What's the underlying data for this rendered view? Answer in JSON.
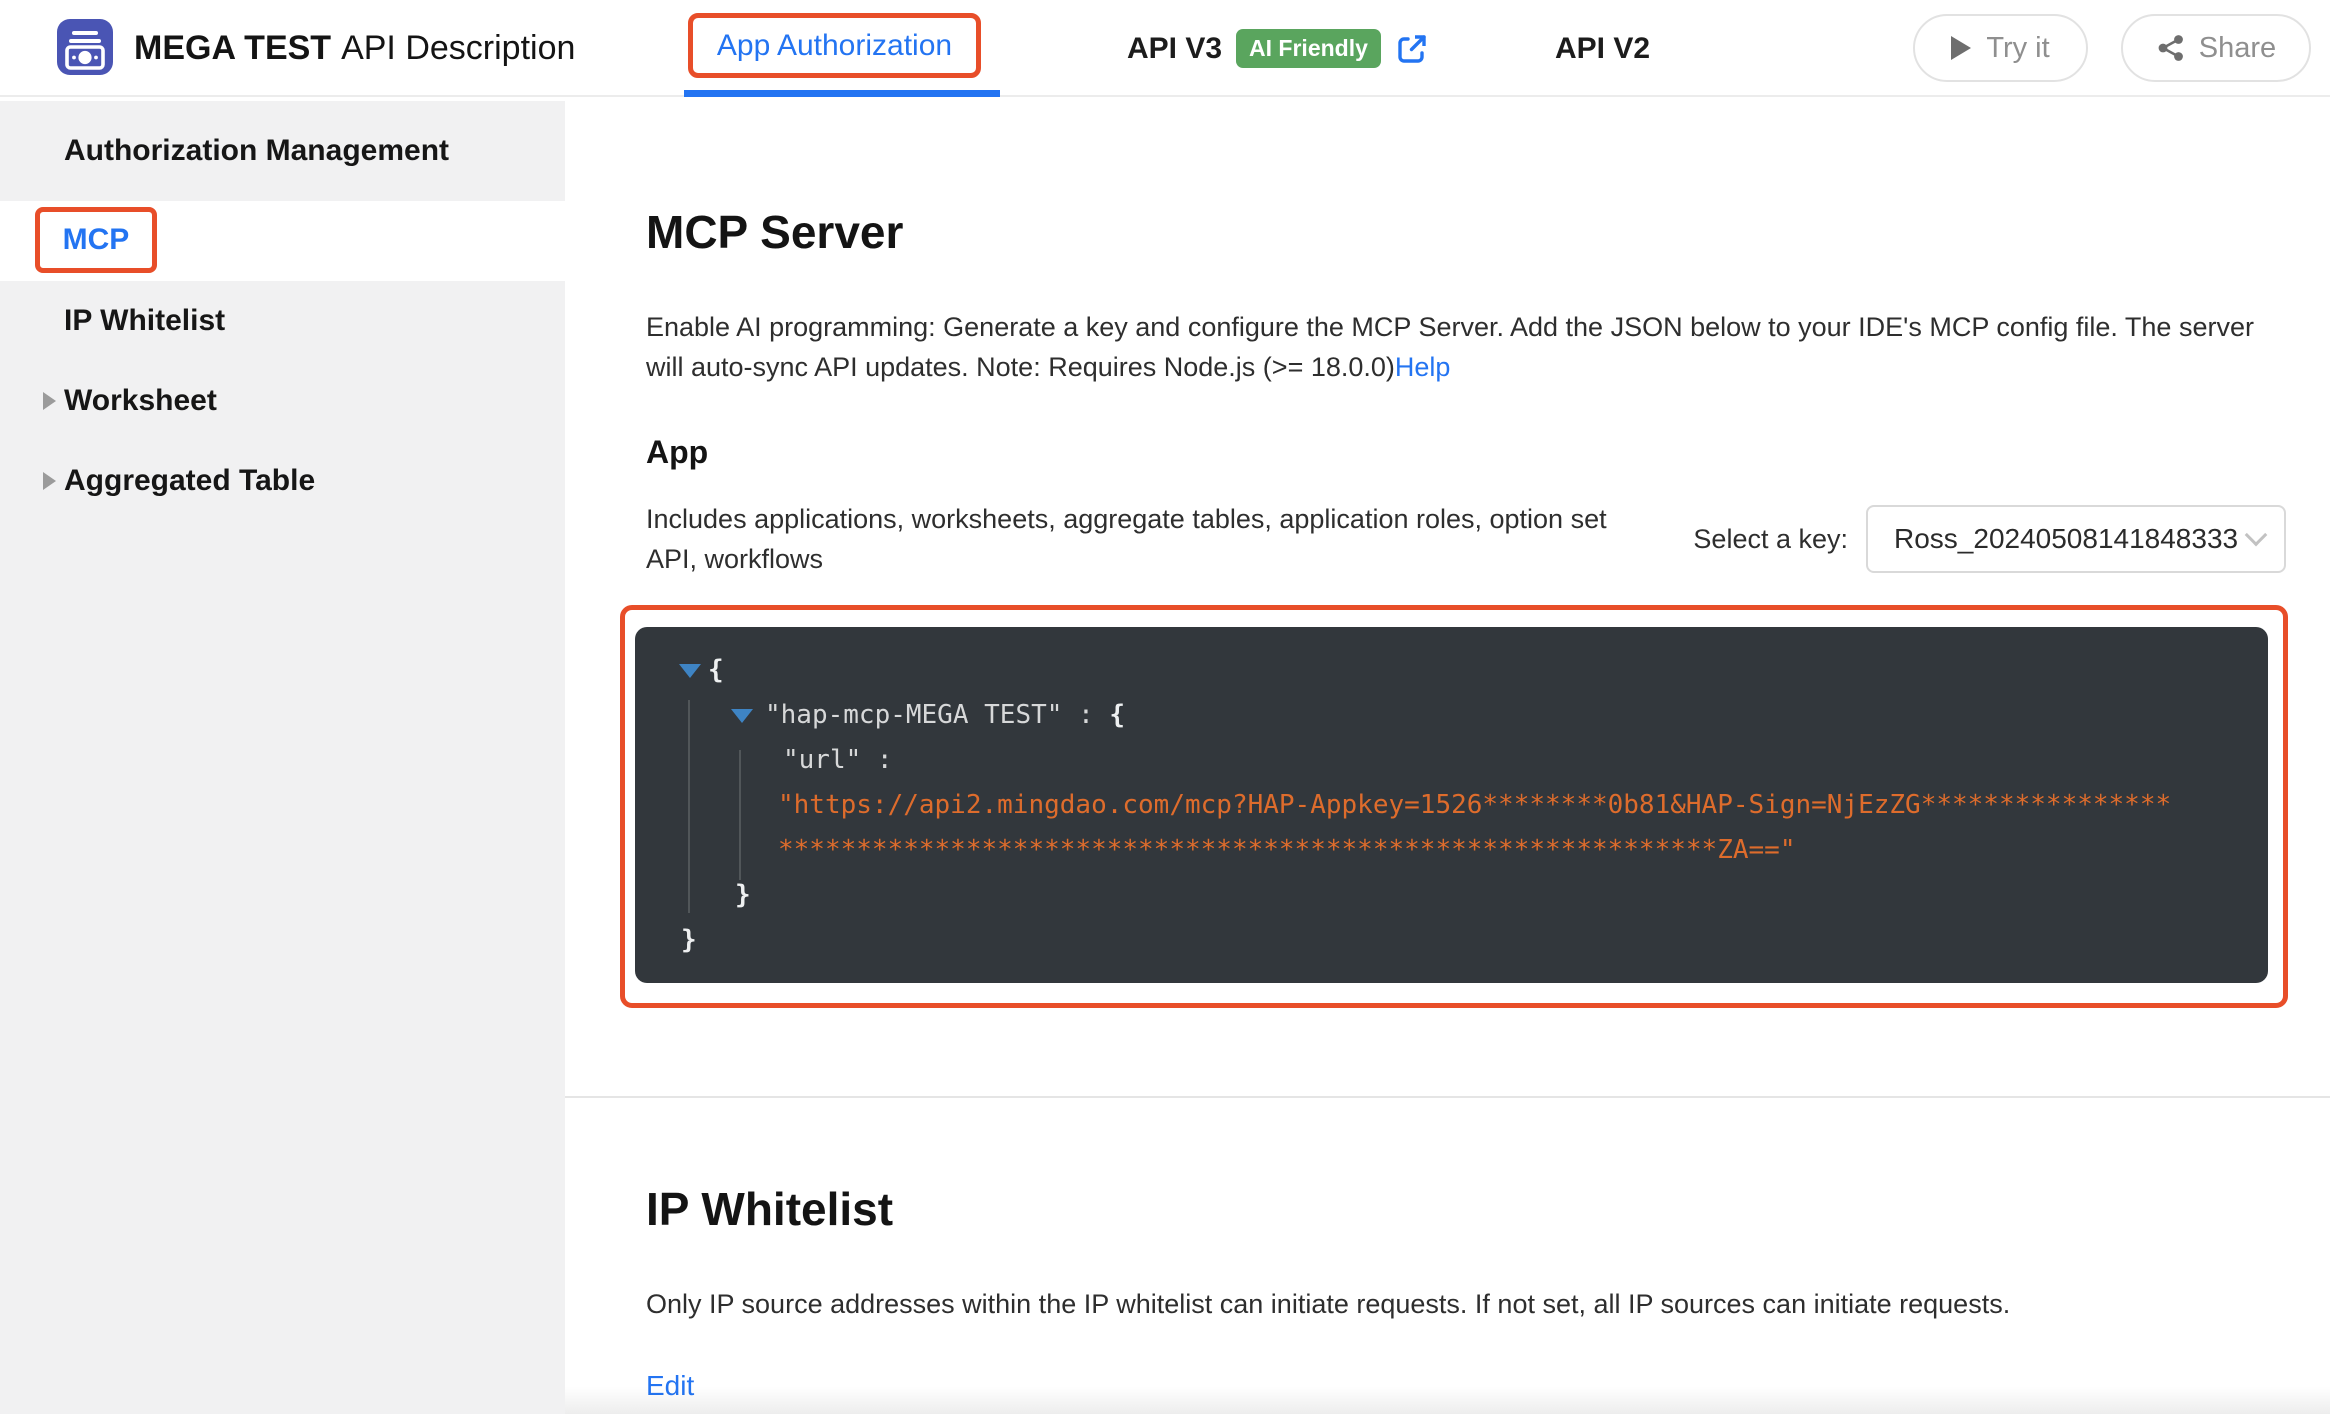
{
  "colors": {
    "accent_blue": "#2374f2",
    "annotation_red": "#e84e29",
    "badge_green": "#5aa55e",
    "logo_indigo": "#4a55b4",
    "sidebar_gray": "#f1f1f2",
    "code_background": "#32373c",
    "code_text": "#d7d8d9",
    "code_string_orange": "#de6c2c",
    "code_collapse_blue": "#3e84c4"
  },
  "header": {
    "logo_icon": "banknote-stack-icon",
    "app_name": "MEGA TEST",
    "title_suffix": "API Description",
    "tabs": [
      {
        "label": "App Authorization",
        "active": true,
        "annotated": true
      },
      {
        "label": "API V3",
        "badge": "AI Friendly",
        "icon": "open-in-new-icon"
      },
      {
        "label": "API V2"
      }
    ],
    "actions": [
      {
        "label": "Try it",
        "icon": "play-icon"
      },
      {
        "label": "Share",
        "icon": "share-icon"
      }
    ]
  },
  "sidebar": {
    "items": [
      {
        "label": "Authorization Management"
      },
      {
        "label": "MCP",
        "active": true,
        "annotated": true
      },
      {
        "label": "IP Whitelist"
      },
      {
        "label": "Worksheet",
        "expandable": true
      },
      {
        "label": "Aggregated Table",
        "expandable": true
      }
    ]
  },
  "main": {
    "mcp": {
      "title": "MCP Server",
      "description": "Enable AI programming: Generate a key and configure the MCP Server. Add the JSON below to your IDE's MCP config file. The server will auto-sync API updates. Note: Requires Node.js (>= 18.0.0)",
      "help_link": "Help",
      "app": {
        "title": "App",
        "description": "Includes applications, worksheets, aggregate tables, application roles, option set API, workflows",
        "key_label": "Select a key:",
        "key_selected": "Ross_20240508141848333"
      },
      "code": {
        "open_brace": "{",
        "key": "\"hap-mcp-MEGA TEST\" : ",
        "key_open_brace": "{",
        "url_label": "\"url\" :",
        "url_line1": "\"https://api2.mingdao.com/mcp?HAP-Appkey=1526********0b81&HAP-Sign=NjEzZG****************",
        "url_line2": "************************************************************ZA==\"",
        "inner_close_brace": "}",
        "outer_close_brace": "}"
      }
    },
    "ip": {
      "title": "IP Whitelist",
      "description": "Only IP source addresses within the IP whitelist can initiate requests. If not set, all IP sources can initiate requests.",
      "edit_link": "Edit"
    }
  }
}
